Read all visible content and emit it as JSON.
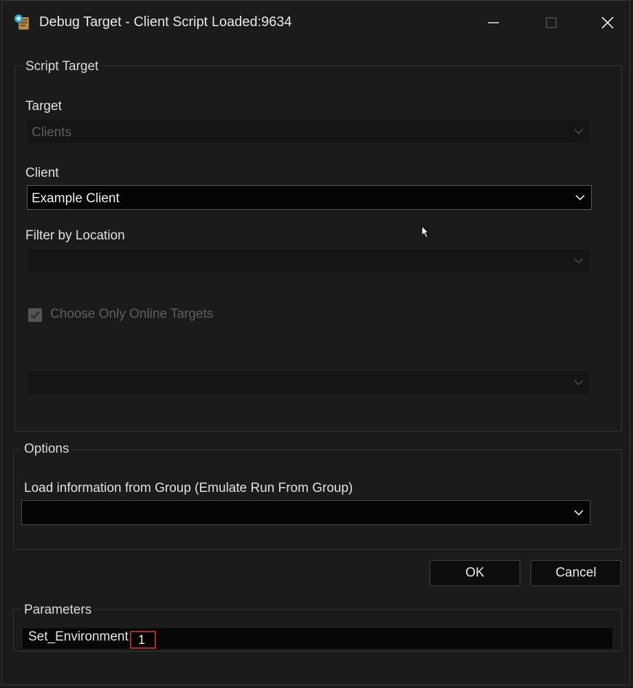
{
  "window": {
    "title": "Debug Target - Client Script Loaded:9634",
    "controls": [
      "minimize-icon",
      "maximize-icon",
      "close-icon"
    ]
  },
  "script_target": {
    "legend": "Script Target",
    "target_label": "Target",
    "target_value": "Clients",
    "client_label": "Client",
    "client_value": "Example Client",
    "location_label": "Filter by Location",
    "location_value": "",
    "online_checkbox_label": "Choose Only Online Targets",
    "online_checkbox_checked": true,
    "extra_combo_value": ""
  },
  "options": {
    "legend": "Options",
    "group_label": "Load information from Group (Emulate Run From Group)",
    "group_value": ""
  },
  "buttons": {
    "ok": "OK",
    "cancel": "Cancel"
  },
  "parameters": {
    "legend": "Parameters",
    "rows": [
      {
        "name": "Set_Environment",
        "value": "1"
      }
    ]
  }
}
